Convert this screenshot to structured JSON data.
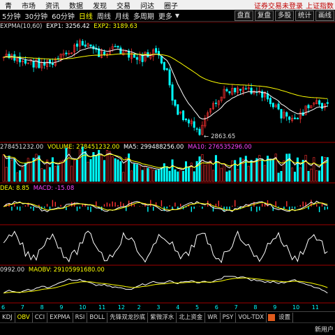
{
  "menu": {
    "items": [
      "青",
      "市场",
      "资讯",
      "数据",
      "发现",
      "交易",
      "问达",
      "圈子"
    ],
    "notice": "证券交易未登录",
    "index_name": "上证指数"
  },
  "period": {
    "tabs": [
      "5分钟",
      "30分钟",
      "60分钟",
      "日线",
      "周线",
      "月线",
      "多周期",
      "更多"
    ],
    "active": 3
  },
  "toolbar": {
    "buttons": [
      "盘直",
      "复盘",
      "多股",
      "统计",
      "画线"
    ]
  },
  "legend_main": {
    "name": "EXPMA(10,60)",
    "exp1": "EXP1: 3256.42",
    "exp2": "EXP2: 3189.63"
  },
  "low_label": "2863.65",
  "legend_volume": {
    "prefix": "278451232.00",
    "volume": "VOLUME: 278451232.00",
    "ma5": "MA5: 299488256.00",
    "ma10": "MA10: 276535296.00"
  },
  "legend_macd": {
    "dea": "DEA: 8.85",
    "macd": "MACD: -15.08"
  },
  "legend_obv": {
    "prefix": "0992.00",
    "maobv": "MAOBV: 29105991680.00"
  },
  "x_labels": [
    "6",
    "7",
    "8",
    "9",
    "10",
    "11",
    "12",
    "2",
    "3",
    "4",
    "5",
    "6",
    "7",
    "8",
    "9",
    "10",
    "11"
  ],
  "indicator_tabs": [
    "KDJ",
    "OBV",
    "CCI",
    "EXPMA",
    "RSI",
    "BOLL",
    "先锋双龙抄底",
    "紫微浮水",
    "北上资金",
    "WR",
    "PSY",
    "VOL-TDX",
    "设置"
  ],
  "active_indicator": 1,
  "status": {
    "text": "新用户"
  },
  "colors": {
    "up": "#ff3232",
    "down": "#00ffff",
    "exp1": "#ffffff",
    "exp2": "#ffff00",
    "accent": "#ffff00",
    "ma5": "#ffffff",
    "ma10": "#ffff00",
    "macd_line": "#ffffff",
    "dea_line": "#ffff00"
  }
}
